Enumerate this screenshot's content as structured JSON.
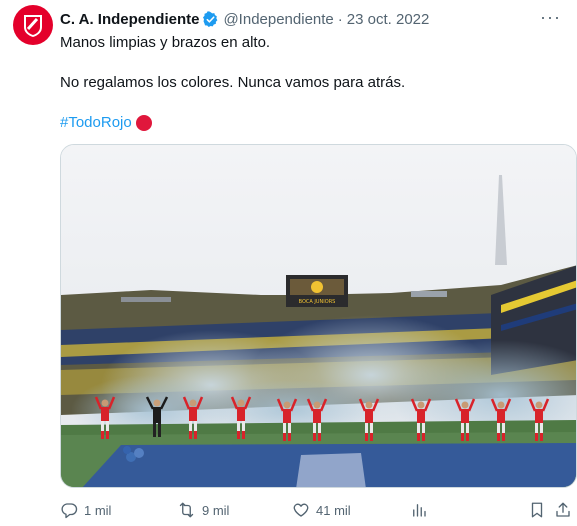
{
  "tweet": {
    "author_name": "C. A. Independiente",
    "handle": "@Independiente",
    "separator": "·",
    "date": "23 oct. 2022",
    "line1": "Manos limpias y brazos en alto.",
    "line2": "No regalamos los colores. Nunca vamos para atrás.",
    "hashtag": "#TodoRojo"
  },
  "media": {
    "scoreboard_text": "BOCA JUNIORS",
    "colors": {
      "sky": "#eef0f3",
      "smoke": "#b7c9d6",
      "pitch": "#4f7a45",
      "shirt": "#d8232a",
      "crowd_yellow": "#c9b13a",
      "crowd_blue": "#203a74"
    }
  },
  "actions": {
    "replies": "1 mil",
    "retweets": "9 mil",
    "likes": "41 mil"
  },
  "colors": {
    "accent": "#1d9bf0",
    "brand_red": "#e4002b",
    "secondary_text": "#536471"
  }
}
